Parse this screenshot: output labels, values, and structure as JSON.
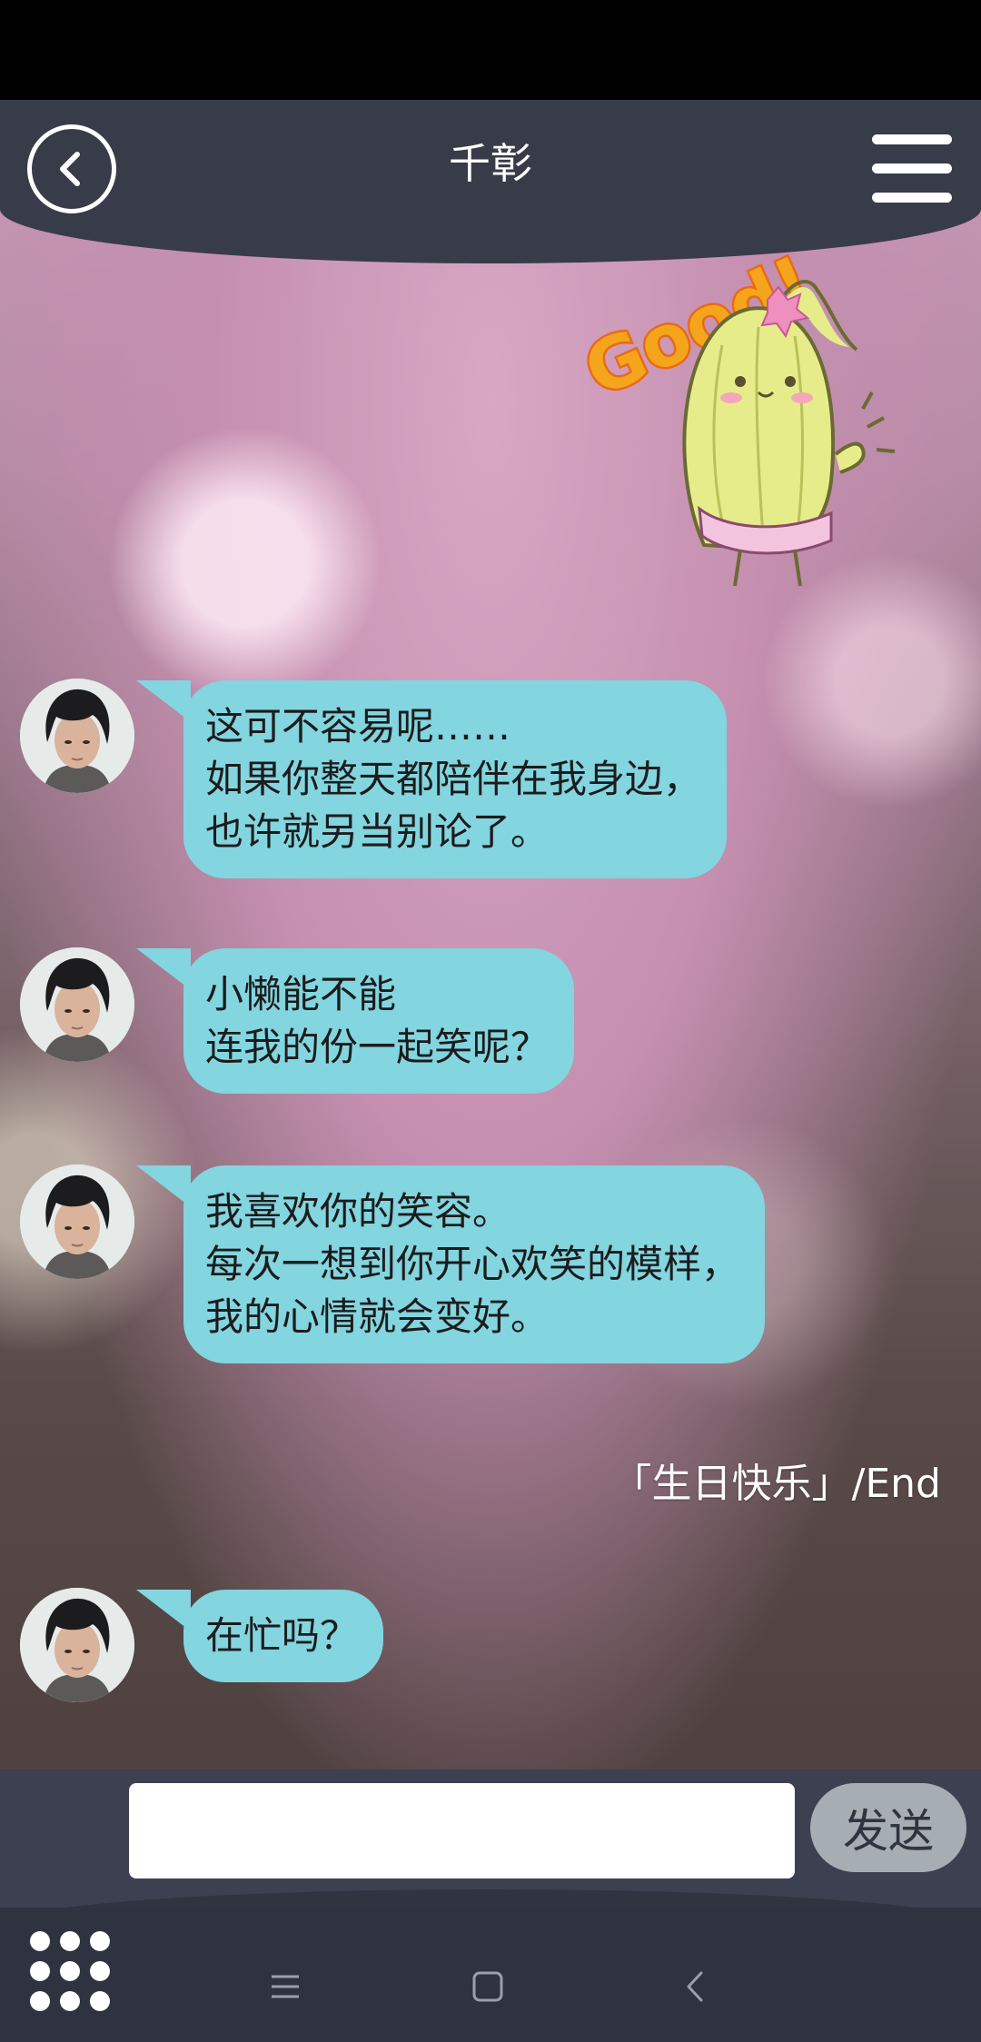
{
  "header": {
    "title": "千彰",
    "back_icon": "back-arrow-circle-icon",
    "menu_icon": "hamburger-menu-icon"
  },
  "sticker": {
    "text": "Good!",
    "description_icon": "cactus-sticker-icon"
  },
  "messages": [
    {
      "lines": [
        "这可不容易呢……",
        "如果你整天都陪伴在我身边，",
        "也许就另当别论了。"
      ]
    },
    {
      "lines": [
        "小懒能不能",
        "连我的份一起笑呢？"
      ]
    },
    {
      "lines": [
        "我喜欢你的笑容。",
        "每次一想到你开心欢笑的模样，",
        "我的心情就会变好。"
      ]
    },
    {
      "lines": [
        "在忙吗？"
      ]
    }
  ],
  "event_label": "「生日快乐」/End",
  "input": {
    "value": "",
    "placeholder": "",
    "send_label": "发送"
  },
  "colors": {
    "bubble": "#83d5df",
    "header": "#383c48",
    "send_button": "#a6aeb3"
  }
}
